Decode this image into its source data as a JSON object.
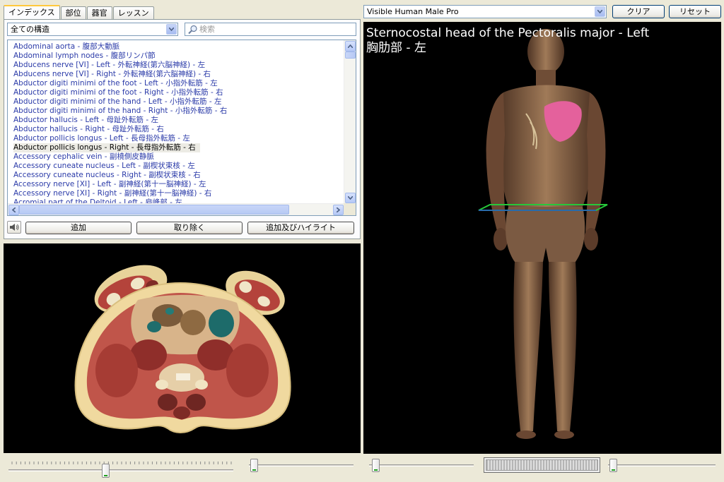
{
  "tabs": [
    {
      "label": "インデックス",
      "active": true
    },
    {
      "label": "部位",
      "active": false
    },
    {
      "label": "器官",
      "active": false
    },
    {
      "label": "レッスン",
      "active": false
    }
  ],
  "filter": {
    "selected": "全ての構造"
  },
  "search": {
    "placeholder": "検索"
  },
  "structure_list": [
    "Abdominal aorta - 腹部大動脈",
    "Abdominal lymph nodes - 腹部リンパ節",
    "Abducens nerve [VI] - Left - 外転神経(第六脳神経) - 左",
    "Abducens nerve [VI] - Right - 外転神経(第六脳神経) - 右",
    "Abductor digiti minimi of the foot - Left - 小指外転筋 - 左",
    "Abductor digiti minimi of the foot - Right - 小指外転筋 - 右",
    "Abductor digiti minimi of the hand - Left - 小指外転筋 - 左",
    "Abductor digiti minimi of the hand - Right - 小指外転筋 - 右",
    "Abductor hallucis - Left - 母趾外転筋 - 左",
    "Abductor hallucis - Right - 母趾外転筋 - 右",
    "Abductor pollicis longus - Left - 長母指外転筋 - 左",
    "Abductor pollicis longus - Right - 長母指外転筋 - 右",
    "Accessory cephalic vein - 副橈側皮静脈",
    "Accessory cuneate nucleus - Left - 副楔状束核 - 左",
    "Accessory cuneate nucleus - Right - 副楔状束核 - 右",
    "Accessory nerve [XI] - Left - 副神経(第十一脳神経) - 左",
    "Accessory nerve [XI] - Right - 副神経(第十一脳神経) - 右",
    "Acromial part of the Deltoid - Left - 肩峰部 - 左"
  ],
  "selected_index": 11,
  "buttons": {
    "add": "追加",
    "remove": "取り除く",
    "add_highlight": "追加及びハイライト"
  },
  "model": {
    "selected": "Visible Human Male Pro"
  },
  "top_buttons": {
    "clear": "クリア",
    "reset": "リセット"
  },
  "viewer": {
    "title_en": "Sternocostal head of the Pectoralis major - Left",
    "title_jp": "胸肋部 - 左"
  },
  "sliders": {
    "slice_position": 0.43,
    "slice_opacity": 0.0,
    "model_opacity": 0.0,
    "model_rotation": 0.0
  },
  "colors": {
    "highlight": "#e4619c",
    "plane": "#27c83a",
    "list_text": "#2a3aa8"
  }
}
